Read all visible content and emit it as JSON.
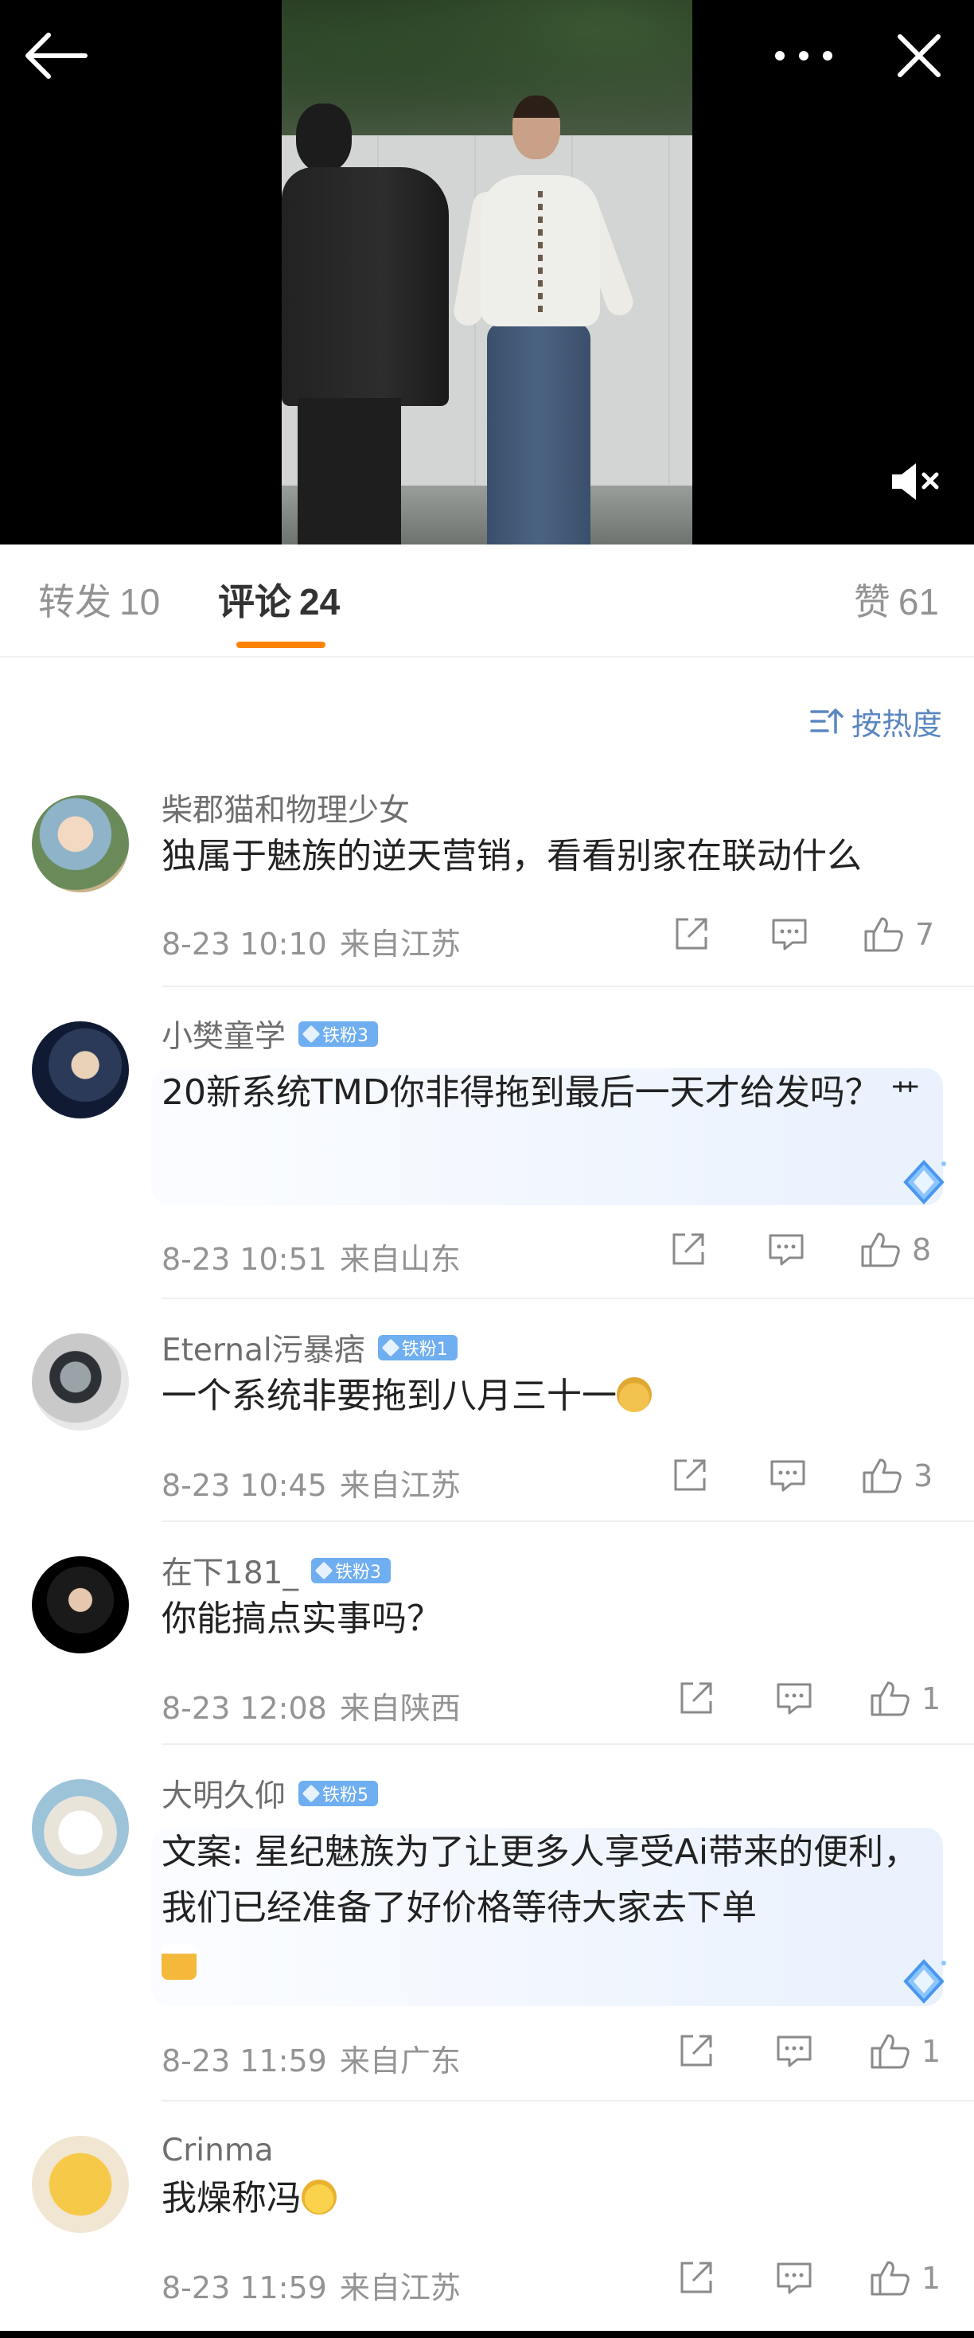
{
  "video": {
    "back_icon": "arrow-left-icon",
    "more_icon": "more-dots-icon",
    "close_icon": "close-icon",
    "mute_icon": "volume-muted-icon"
  },
  "tabs": {
    "repost": {
      "label": "转发",
      "count": "10"
    },
    "comments": {
      "label": "评论",
      "count": "24"
    },
    "likes": {
      "label": "赞",
      "count": "61"
    },
    "accent_color": "#ff8200"
  },
  "sort": {
    "label": "按热度",
    "icon": "sort-icon",
    "color": "#5b87c0"
  },
  "comments": [
    {
      "user": "柴郡猫和物理少女",
      "badge": "",
      "text": "独属于魅族的逆天营销，看看别家在联动什么",
      "time": "8-23 10:10",
      "location": "来自江苏",
      "likes": "7"
    },
    {
      "user": "小樊童学",
      "badge": "铁粉3",
      "text": "20新系统TMD你非得拖到最后一天才给发吗？",
      "emoji": "艹",
      "time": "8-23 10:51",
      "location": "来自山东",
      "likes": "8"
    },
    {
      "user": "Eternal污暴痞",
      "badge": "铁粉1",
      "text": "一个系统非要拖到八月三十一",
      "emoji_icon": "doge-emoji-icon",
      "time": "8-23 10:45",
      "location": "来自江苏",
      "likes": "3"
    },
    {
      "user": "在下181_",
      "badge": "铁粉3",
      "text": "你能搞点实事吗？",
      "time": "8-23 12:08",
      "location": "来自陕西",
      "likes": "1"
    },
    {
      "user": "大明久仰",
      "badge": "铁粉5",
      "text": "文案: 星纪魅族为了让更多人享受Ai带来的便利，我们已经准备了好价格等待大家去下单",
      "emoji_icon": "cheers-emoji-icon",
      "time": "8-23 11:59",
      "location": "来自广东",
      "likes": "1"
    },
    {
      "user": "Crinma",
      "badge": "",
      "text": "我燥称冯",
      "emoji_icon": "scared-emoji-icon",
      "time": "8-23 11:59",
      "location": "来自江苏",
      "likes": "1"
    }
  ]
}
